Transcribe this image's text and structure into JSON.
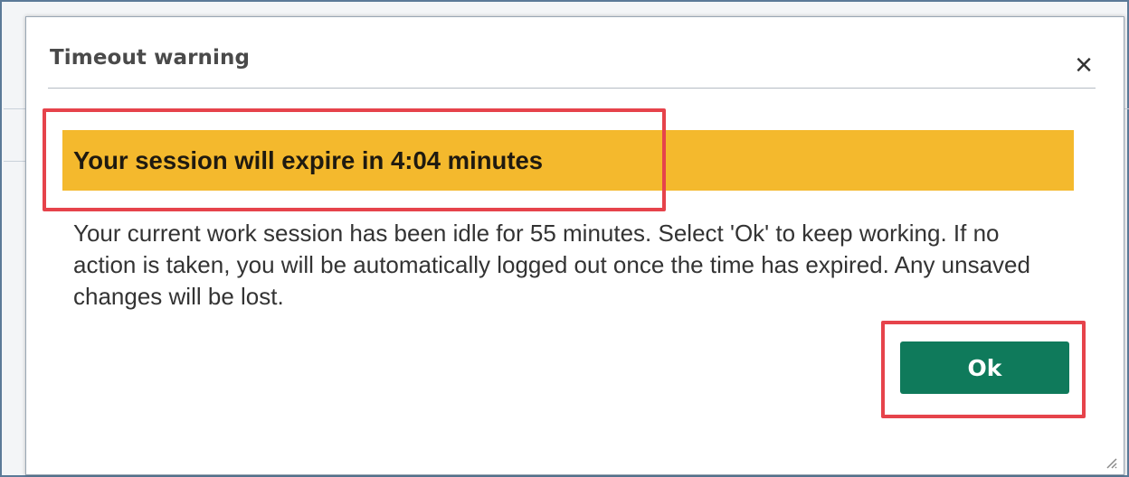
{
  "dialog": {
    "title": "Timeout warning",
    "close_icon": "close-icon",
    "banner_text": "Your session will expire in 4:04 minutes",
    "message": "Your current work session has been idle for 55 minutes. Select 'Ok' to keep working. If no action is taken, you will be automatically logged out once the time has expired. Any unsaved changes will be lost.",
    "ok_label": "Ok",
    "resize_icon": "resize-grip-icon"
  },
  "colors": {
    "banner": "#f4b92d",
    "ok_button": "#0f7a5b",
    "highlight": "#e6434b"
  }
}
